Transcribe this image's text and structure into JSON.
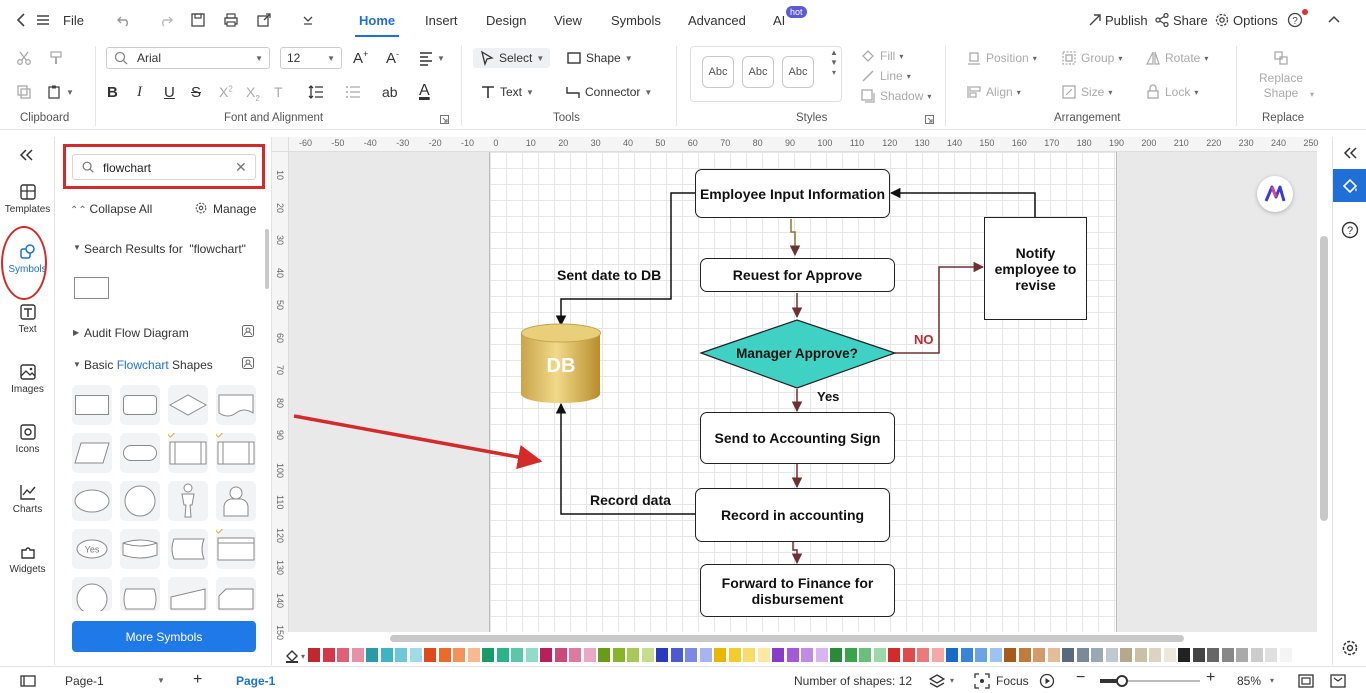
{
  "menu": {
    "file": "File",
    "tabs": [
      "Home",
      "Insert",
      "Design",
      "View",
      "Symbols",
      "Advanced",
      "AI"
    ],
    "hot_badge": "hot",
    "publish": "Publish",
    "share": "Share",
    "options": "Options"
  },
  "ribbon": {
    "groups": {
      "clipboard": "Clipboard",
      "font": "Font and Alignment",
      "tools": "Tools",
      "styles": "Styles",
      "arrangement": "Arrangement",
      "replace": "Replace"
    },
    "font_family": "Arial",
    "font_size": "12",
    "select": "Select",
    "shape": "Shape",
    "text": "Text",
    "connector": "Connector",
    "style_sample": "Abc",
    "fill": "Fill",
    "line": "Line",
    "shadow": "Shadow",
    "position": "Position",
    "group": "Group",
    "rotate": "Rotate",
    "align": "Align",
    "size": "Size",
    "lock": "Lock",
    "replace_shape": "Replace Shape"
  },
  "leftbar": [
    "Templates",
    "Symbols",
    "Text",
    "Images",
    "Icons",
    "Charts",
    "Widgets"
  ],
  "panel": {
    "search_value": "flowchart",
    "collapse_all": "Collapse All",
    "manage": "Manage",
    "search_results": "Search Results for  \"flowchart\"",
    "audit": "Audit Flow Diagram",
    "basic_prefix": "Basic ",
    "basic_highlight": "Flowchart",
    "basic_suffix": " Shapes",
    "yes_sample": "Yes",
    "more_symbols": "More Symbols"
  },
  "ruler_top": [
    "-60",
    "-50",
    "-40",
    "-30",
    "-20",
    "-10",
    "0",
    "10",
    "20",
    "30",
    "40",
    "50",
    "60",
    "70",
    "80",
    "90",
    "100",
    "110",
    "120",
    "130",
    "140",
    "150",
    "160",
    "170",
    "180",
    "190",
    "200",
    "210",
    "220",
    "230",
    "240",
    "250"
  ],
  "ruler_left": [
    "10",
    "20",
    "30",
    "40",
    "50",
    "60",
    "70",
    "80",
    "90",
    "100",
    "110",
    "120",
    "130",
    "140",
    "150"
  ],
  "diagram": {
    "employee": "Employee Input Information",
    "request": "Reuest for Approve",
    "manager": "Manager Approve?",
    "send": "Send to Accounting Sign",
    "record": "Record in  accounting",
    "forward": "Forward to Finance for disbursement",
    "notify": "Notify employee to revise",
    "db": "DB",
    "sent_label": "Sent date to DB",
    "record_label": "Record data",
    "no_label": "NO",
    "yes_label": "Yes"
  },
  "colors": {
    "accent": "#1f6fd6",
    "diamond": "#3fd1c3",
    "arrow_red": "#d42a2a",
    "no_text": "#c0282e",
    "conn_brown": "#7a3a3a"
  },
  "status": {
    "page_select": "Page-1",
    "page_tab": "Page-1",
    "shapes": "Number of shapes: 12",
    "focus": "Focus",
    "zoom": "85%"
  }
}
